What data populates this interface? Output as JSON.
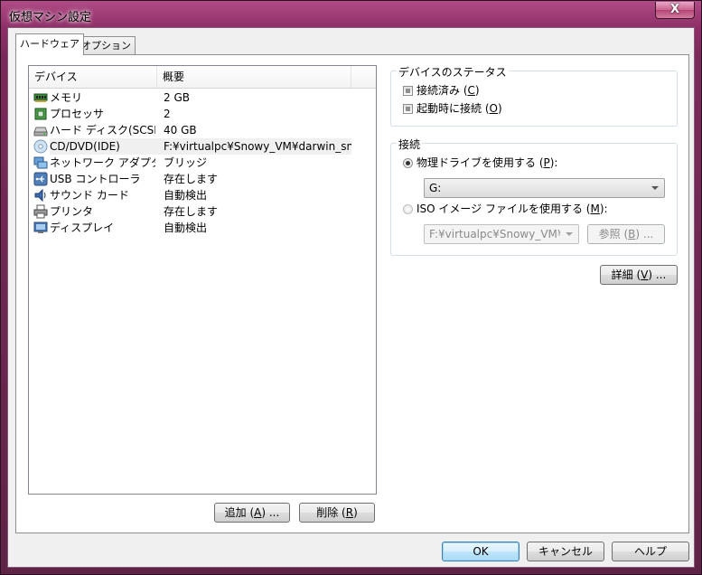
{
  "window": {
    "title": "仮想マシン設定",
    "close_label": "X"
  },
  "tabs": [
    {
      "label": "ハードウェア",
      "active": true
    },
    {
      "label": "オプション",
      "active": false
    }
  ],
  "device_list": {
    "columns": [
      "デバイス",
      "概要"
    ],
    "rows": [
      {
        "device": "メモリ",
        "summary": "2 GB",
        "icon": "memory-icon"
      },
      {
        "device": "プロセッサ",
        "summary": "2",
        "icon": "processor-icon"
      },
      {
        "device": "ハード ディスク(SCSI)",
        "summary": "40 GB",
        "icon": "hard-disk-icon"
      },
      {
        "device": "CD/DVD(IDE)",
        "summary": "F:¥virtualpc¥Snowy_VM¥darwin_sn...",
        "icon": "cd-dvd-icon",
        "selected": true
      },
      {
        "device": "ネットワーク アダプタ",
        "summary": "ブリッジ",
        "icon": "network-adapter-icon"
      },
      {
        "device": "USB コントローラ",
        "summary": "存在します",
        "icon": "usb-icon"
      },
      {
        "device": "サウンド カード",
        "summary": "自動検出",
        "icon": "sound-card-icon"
      },
      {
        "device": "プリンタ",
        "summary": "存在します",
        "icon": "printer-icon"
      },
      {
        "device": "ディスプレイ",
        "summary": "自動検出",
        "icon": "display-icon"
      }
    ]
  },
  "buttons": {
    "add": {
      "pre": "追加 (",
      "key": "A",
      "post": ") ..."
    },
    "remove": {
      "pre": "削除 (",
      "key": "R",
      "post": ")"
    },
    "browse": {
      "pre": "参照 (",
      "key": "B",
      "post": ") ..."
    },
    "advanced": {
      "pre": "詳細 (",
      "key": "V",
      "post": ") ..."
    },
    "ok": "OK",
    "cancel": "キャンセル",
    "help": "ヘルプ"
  },
  "device_status": {
    "title": "デバイスのステータス",
    "connected": {
      "pre": "接続済み (",
      "key": "C",
      "post": ")"
    },
    "connect_on_power_on": {
      "pre": "起動時に接続 (",
      "key": "O",
      "post": ")"
    }
  },
  "connection": {
    "title": "接続",
    "physical_drive": {
      "pre": "物理ドライブを使用する (",
      "key": "P",
      "post": "):",
      "selected": true
    },
    "drive_value": "G:",
    "iso_image": {
      "pre": "ISO イメージ ファイルを使用する (",
      "key": "M",
      "post": "):",
      "selected": false
    },
    "iso_path": "F:¥virtualpc¥Snowy_VM¥da"
  },
  "colors": {
    "titlebar": "#8e2f68",
    "dialog_bg": "#f0f0f0",
    "selection": "#f0f0f0"
  }
}
